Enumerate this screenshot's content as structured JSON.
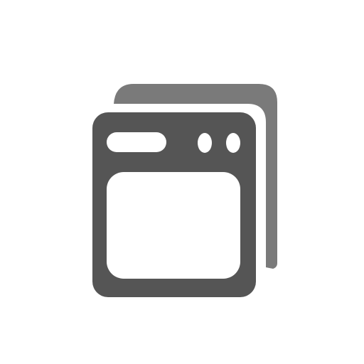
{
  "icon": {
    "name": "windows-stack-icon",
    "colors": {
      "back_window": "#7a7a7a",
      "front_window": "#555555",
      "cutout": "#ffffff",
      "background": "#ffffff"
    }
  }
}
